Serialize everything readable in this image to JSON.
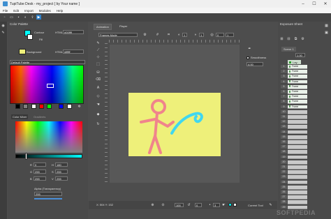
{
  "window": {
    "title": "TupiTube Desk - my_project [ by Your name ]",
    "controls": [
      "–",
      "☐",
      "✕"
    ]
  },
  "menu": [
    "File",
    "Edit",
    "Import",
    "Modules",
    "Help"
  ],
  "color_panel": {
    "title": "Color Palette",
    "contour_label": "Contour",
    "fill_label": "Fill",
    "html_label": "HTML",
    "contour_html": "#00ffff",
    "background_label": "Background",
    "background_html": "#ffffff",
    "palette_select": "Default Palette",
    "mixer_tab": "Color Mixer",
    "gradients_tab": "Gradients",
    "rgb_fields": [
      {
        "label": "R",
        "value": "0"
      },
      {
        "label": "G",
        "value": "255"
      },
      {
        "label": "B",
        "value": "255"
      }
    ],
    "hsv_fields": [
      {
        "label": "H",
        "value": "180"
      },
      {
        "label": "S",
        "value": "255"
      },
      {
        "label": "V",
        "value": "255"
      }
    ],
    "alpha_label": "Alpha (Transparency)",
    "alpha_value": "255"
  },
  "stage": {
    "tabs": [
      {
        "label": "Animation"
      },
      {
        "label": "Player"
      }
    ],
    "mode_select": "Frames Mode",
    "frame_value": "1",
    "layer_value": "1",
    "counter_value": "0",
    "zoom_value": "1",
    "status_coords": "X: 504 Y: 152",
    "zoom_percent": "100",
    "rotation": "0",
    "pen_size": "3",
    "current_tool_label": "Current Tool",
    "smoothness_label": "Smoothness",
    "smoothness_value": "4.00"
  },
  "exposure": {
    "title": "Exposure Sheet",
    "scene_tab": "Scene 1",
    "layer_spin": "1.00",
    "layer_name": "Lay...",
    "rows": [
      "1",
      "2",
      "3",
      "4",
      "5",
      "6",
      "7",
      "8",
      "9",
      "10",
      "11",
      "12",
      "13",
      "14",
      "15",
      "16",
      "17",
      "18",
      "19",
      "20",
      "21",
      "22",
      "23",
      "24",
      "25",
      "26",
      "27",
      "28",
      "29"
    ],
    "frame_names": [
      "Frame",
      "Frame",
      "Frame",
      "Frame",
      "Frame",
      "Frame",
      "Frame",
      "Frame",
      "Frame"
    ]
  },
  "colors": {
    "accent": "#00ffff",
    "canvas_bg": "#eef07a",
    "pen": "#f0848c"
  },
  "watermark": "SOFTPEDIA"
}
